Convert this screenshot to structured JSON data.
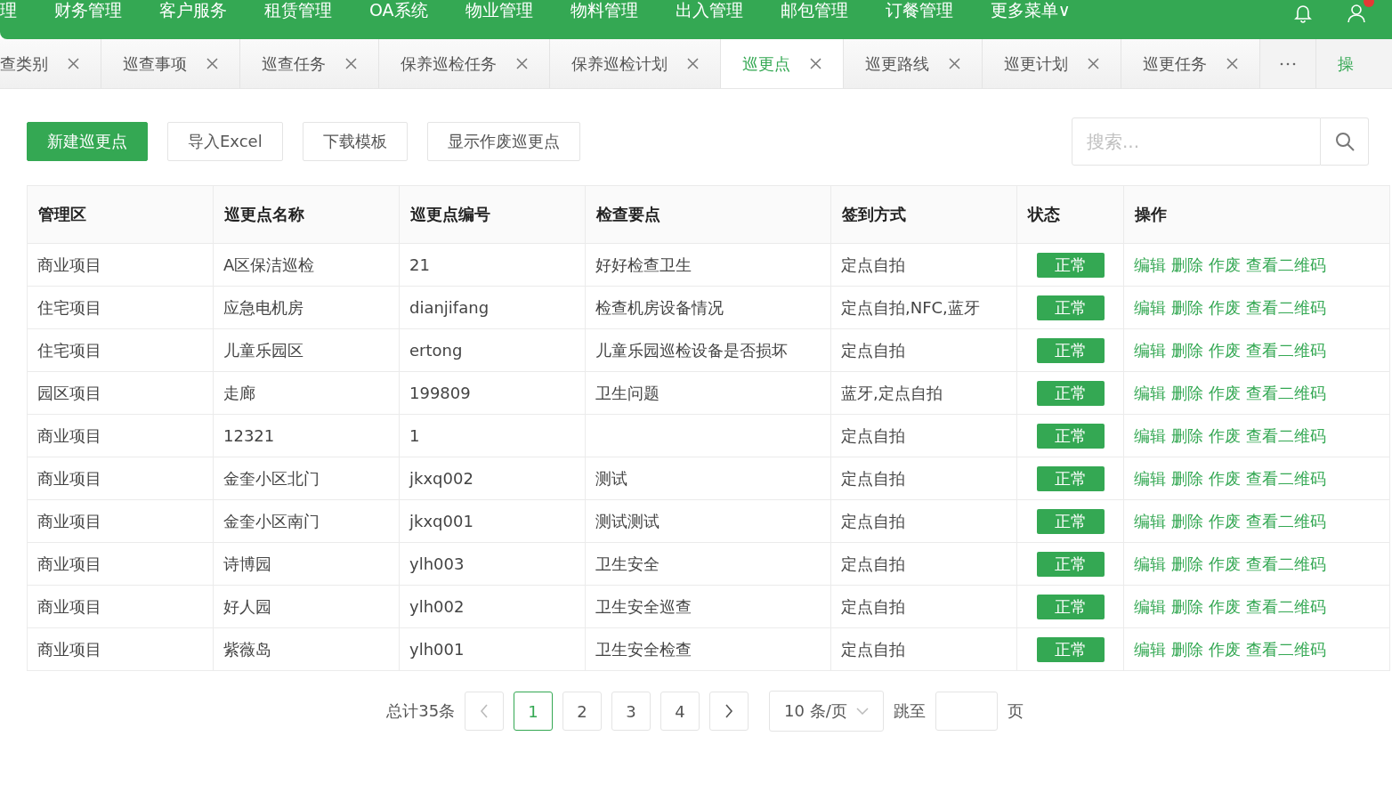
{
  "top_menu": [
    "理",
    "财务管理",
    "客户服务",
    "租赁管理",
    "OA系统",
    "物业管理",
    "物料管理",
    "出入管理",
    "邮包管理",
    "订餐管理",
    "更多菜单∨"
  ],
  "tabs": [
    {
      "label": "查类别",
      "selected": false
    },
    {
      "label": "巡查事项",
      "selected": false
    },
    {
      "label": "巡查任务",
      "selected": false
    },
    {
      "label": "保养巡检任务",
      "selected": false
    },
    {
      "label": "保养巡检计划",
      "selected": false
    },
    {
      "label": "巡更点",
      "selected": true
    },
    {
      "label": "巡更路线",
      "selected": false
    },
    {
      "label": "巡更计划",
      "selected": false
    },
    {
      "label": "巡更任务",
      "selected": false
    }
  ],
  "tab_extra": "操",
  "toolbar": {
    "buttons": [
      {
        "label": "新建巡更点",
        "kind": "primary"
      },
      {
        "label": "导入Excel",
        "kind": "default"
      },
      {
        "label": "下载模板",
        "kind": "default"
      },
      {
        "label": "显示作废巡更点",
        "kind": "default"
      }
    ],
    "search": {
      "placeholder": "搜索..."
    }
  },
  "table": {
    "columns": [
      "管理区",
      "巡更点名称",
      "巡更点编号",
      "检查要点",
      "签到方式",
      "状态",
      "操作"
    ],
    "rows": [
      {
        "cells": [
          "商业项目",
          "A区保洁巡检",
          "21",
          "好好检查卫生",
          "定点自拍"
        ],
        "status": "正常",
        "actions": [
          "编辑",
          "删除",
          "作废",
          "查看二维码"
        ]
      },
      {
        "cells": [
          "住宅项目",
          "应急电机房",
          "dianjifang",
          "检查机房设备情况",
          "定点自拍,NFC,蓝牙"
        ],
        "status": "正常",
        "actions": [
          "编辑",
          "删除",
          "作废",
          "查看二维码"
        ]
      },
      {
        "cells": [
          "住宅项目",
          "儿童乐园区",
          "ertong",
          "儿童乐园巡检设备是否损坏",
          "定点自拍"
        ],
        "status": "正常",
        "actions": [
          "编辑",
          "删除",
          "作废",
          "查看二维码"
        ]
      },
      {
        "cells": [
          "园区项目",
          "走廊",
          "199809",
          "卫生问题",
          "蓝牙,定点自拍"
        ],
        "status": "正常",
        "actions": [
          "编辑",
          "删除",
          "作废",
          "查看二维码"
        ]
      },
      {
        "cells": [
          "商业项目",
          "12321",
          "1",
          "",
          "定点自拍"
        ],
        "status": "正常",
        "actions": [
          "编辑",
          "删除",
          "作废",
          "查看二维码"
        ]
      },
      {
        "cells": [
          "商业项目",
          "金奎小区北门",
          "jkxq002",
          "测试",
          "定点自拍"
        ],
        "status": "正常",
        "actions": [
          "编辑",
          "删除",
          "作废",
          "查看二维码"
        ]
      },
      {
        "cells": [
          "商业项目",
          "金奎小区南门",
          "jkxq001",
          "测试测试",
          "定点自拍"
        ],
        "status": "正常",
        "actions": [
          "编辑",
          "删除",
          "作废",
          "查看二维码"
        ]
      },
      {
        "cells": [
          "商业项目",
          "诗博园",
          "ylh003",
          "卫生安全",
          "定点自拍"
        ],
        "status": "正常",
        "actions": [
          "编辑",
          "删除",
          "作废",
          "查看二维码"
        ]
      },
      {
        "cells": [
          "商业项目",
          "好人园",
          "ylh002",
          "卫生安全巡查",
          "定点自拍"
        ],
        "status": "正常",
        "actions": [
          "编辑",
          "删除",
          "作废",
          "查看二维码"
        ]
      },
      {
        "cells": [
          "商业项目",
          "紫薇岛",
          "ylh001",
          "卫生安全检查",
          "定点自拍"
        ],
        "status": "正常",
        "actions": [
          "编辑",
          "删除",
          "作废",
          "查看二维码"
        ]
      }
    ]
  },
  "pagination": {
    "total": "总计35条",
    "pages": [
      {
        "label": "1",
        "selected": true
      },
      {
        "label": "2",
        "selected": false
      },
      {
        "label": "3",
        "selected": false
      },
      {
        "label": "4",
        "selected": false
      }
    ],
    "page_size": "10 条/页",
    "jump_label": "跳至",
    "page_unit": "页"
  }
}
